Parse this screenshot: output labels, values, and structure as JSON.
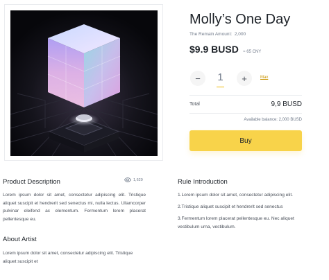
{
  "product": {
    "title": "Molly’s One Day",
    "remain_label": "The Remain Amount:",
    "remain_value": "2,000",
    "price": "$9.9 BUSD",
    "price_cny": "≈ 65 CNY"
  },
  "purchase": {
    "quantity": "1",
    "minus_label": "−",
    "plus_label": "+",
    "max_label": "Max",
    "total_label": "Total",
    "total_value": "9,9 BUSD",
    "balance": "Available balance: 2,000 BUSD",
    "buy_label": "Buy"
  },
  "description": {
    "heading": "Product Description",
    "views": "1,629",
    "text": "Lorem ipsum dolor sit amet, consectetur adipiscing elit. Tristique aliquet suscipit et hendrerit sed senectus mi, nulla lectus. Ullamcorper pulvinar eleifend ac elementum. Fermentum lorem placerat pellentesque eu."
  },
  "artist": {
    "heading": "About Artist",
    "text": "Lorem ipsum dolor sit amet, consectetur adipiscing elit. Tristique aliquet suscipit et"
  },
  "rules": {
    "heading": "Rule Introduction",
    "items": [
      "1.Lorem ipsum dolor sit amet, consectetur adipiscing elit.",
      "2.Tristique aliquet suscipit et hendrerit sed senectus",
      "3.Fermentum lorem placerat pellentesque eu. Nec aliquet vestibulum urna, vestibulum."
    ]
  },
  "colors": {
    "accent": "#f8d34a",
    "link": "#c99400",
    "text_primary": "#1e2329",
    "text_secondary": "#707a8a"
  },
  "icons": {
    "views": "eye-icon",
    "artwork": "glowing-cube-artwork"
  }
}
